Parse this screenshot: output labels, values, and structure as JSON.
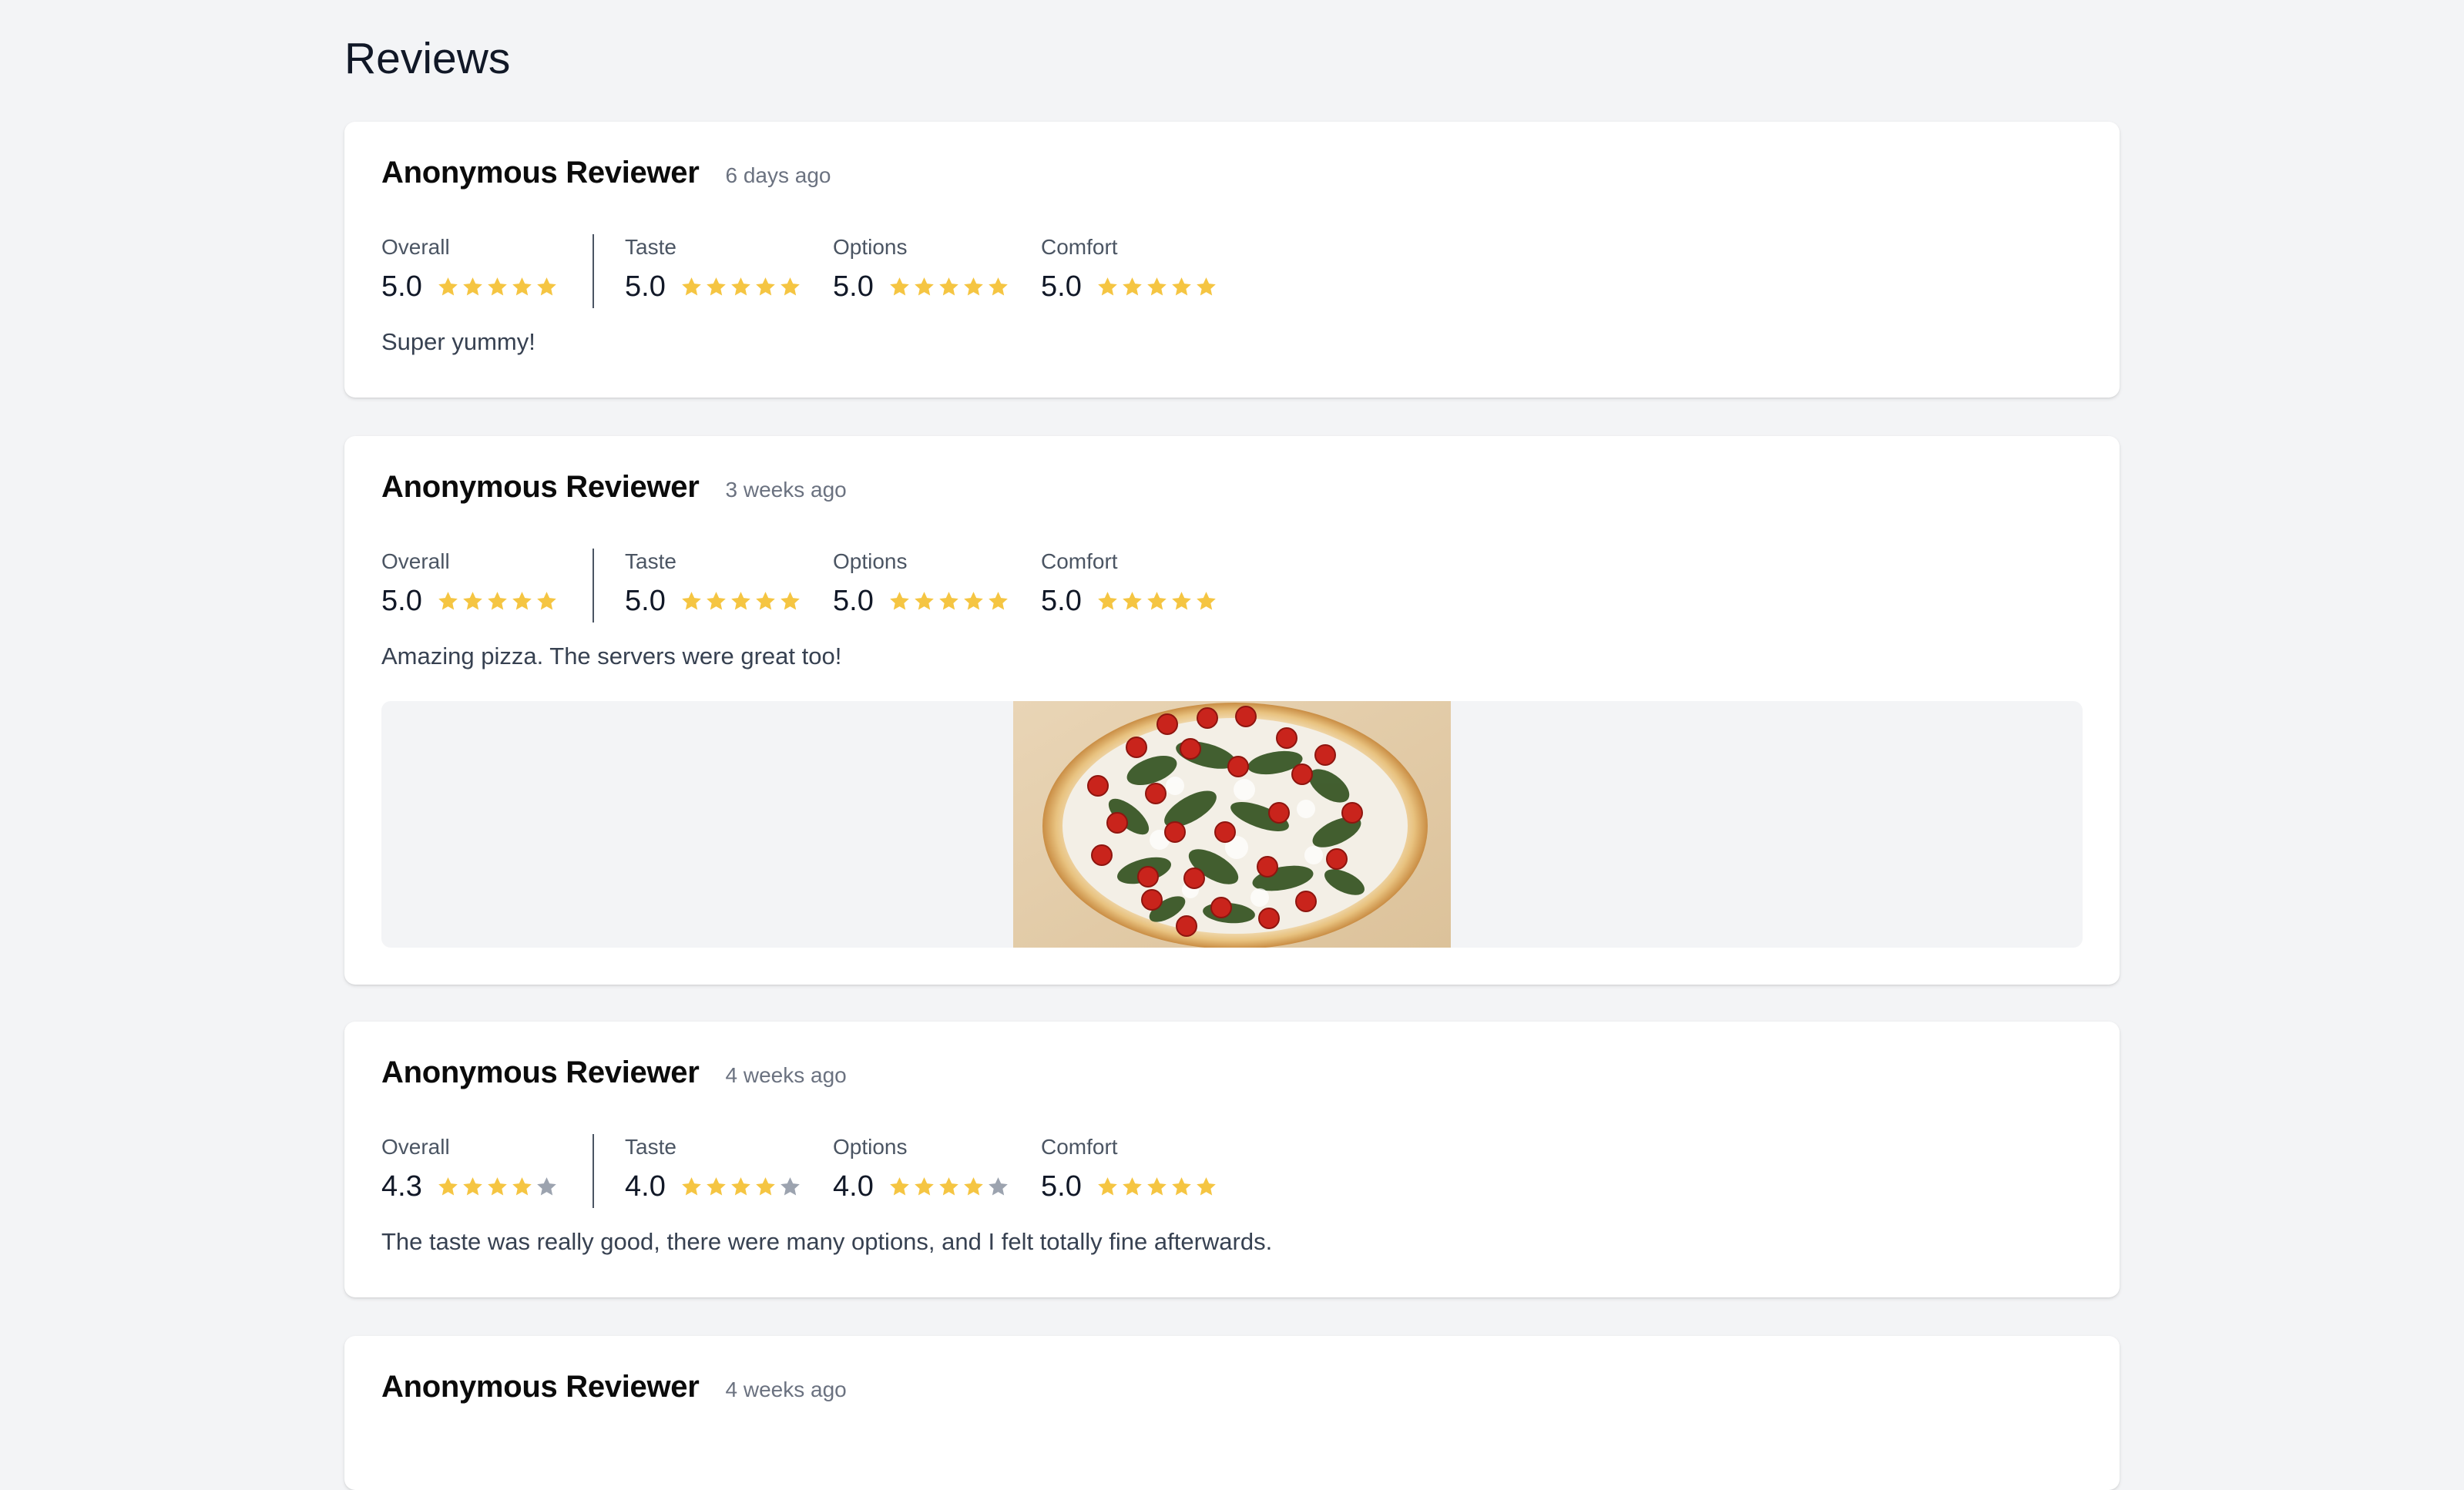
{
  "page": {
    "title": "Reviews"
  },
  "colors": {
    "star_filled": "#f5c542",
    "star_empty": "#9ca3af",
    "background": "#f3f4f6",
    "card": "#ffffff"
  },
  "reviews": [
    {
      "reviewer": "Anonymous Reviewer",
      "time": "6 days ago",
      "ratings": {
        "overall": {
          "label": "Overall",
          "value": "5.0",
          "stars": 5
        },
        "taste": {
          "label": "Taste",
          "value": "5.0",
          "stars": 5
        },
        "options": {
          "label": "Options",
          "value": "5.0",
          "stars": 5
        },
        "comfort": {
          "label": "Comfort",
          "value": "5.0",
          "stars": 5
        }
      },
      "comment": "Super yummy!",
      "has_photo": false
    },
    {
      "reviewer": "Anonymous Reviewer",
      "time": "3 weeks ago",
      "ratings": {
        "overall": {
          "label": "Overall",
          "value": "5.0",
          "stars": 5
        },
        "taste": {
          "label": "Taste",
          "value": "5.0",
          "stars": 5
        },
        "options": {
          "label": "Options",
          "value": "5.0",
          "stars": 5
        },
        "comfort": {
          "label": "Comfort",
          "value": "5.0",
          "stars": 5
        }
      },
      "comment": "Amazing pizza. The servers were great too!",
      "has_photo": true,
      "photo_icon": "pizza-photo"
    },
    {
      "reviewer": "Anonymous Reviewer",
      "time": "4 weeks ago",
      "ratings": {
        "overall": {
          "label": "Overall",
          "value": "4.3",
          "stars": 4
        },
        "taste": {
          "label": "Taste",
          "value": "4.0",
          "stars": 4
        },
        "options": {
          "label": "Options",
          "value": "4.0",
          "stars": 4
        },
        "comfort": {
          "label": "Comfort",
          "value": "5.0",
          "stars": 5
        }
      },
      "comment": "The taste was really good, there were many options, and I felt totally fine afterwards.",
      "has_photo": false
    },
    {
      "reviewer": "Anonymous Reviewer",
      "time": "4 weeks ago"
    }
  ]
}
